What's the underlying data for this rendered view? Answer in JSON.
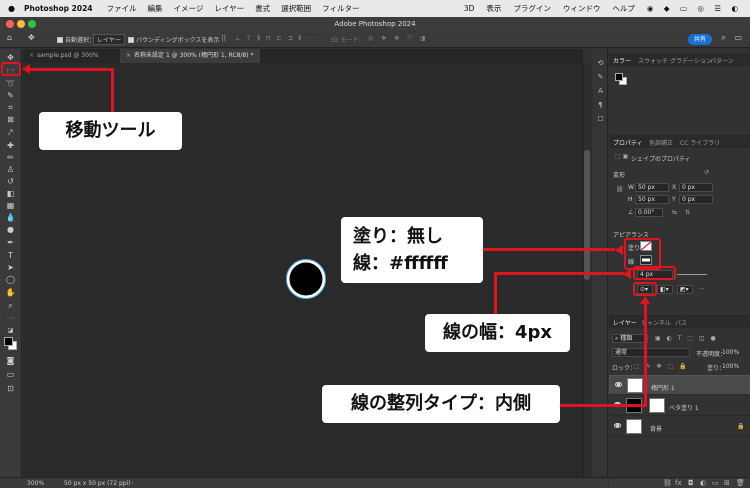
{
  "menubar": {
    "app": "Photoshop 2024",
    "items": [
      "ファイル",
      "編集",
      "イメージ",
      "レイヤー",
      "書式",
      "選択範囲",
      "フィルター",
      "3D",
      "表示",
      "プラグイン",
      "ウィンドウ",
      "ヘルプ"
    ]
  },
  "window_title": "Adobe Photoshop 2024",
  "options_bar": {
    "auto_select_label": "自動選択：",
    "auto_select_value": "レイヤー",
    "bounding_box_label": "バウンディングボックスを表示",
    "mode_3d": "3D モード：",
    "share_label": "共有"
  },
  "tabs": [
    {
      "label": "sample.psd @ 300% (RC8/8)"
    },
    {
      "label": "名称未設定 1 @ 300% (楕円形 1, RC8/8) *"
    }
  ],
  "panels": {
    "color_tabs": [
      "カラー",
      "スウォッチ",
      "グラデーション",
      "パターン"
    ],
    "prop_tabs": [
      "プロパティ",
      "色調補正",
      "CC ライブラリ"
    ],
    "shape_props": "シェイプのプロパティ",
    "transform_label": "変形",
    "w_label": "W",
    "w_value": "50 px",
    "h_label": "H",
    "h_value": "50 px",
    "x_label": "X",
    "x_value": "0 px",
    "y_label": "Y",
    "y_value": "0 px",
    "angle_value": "0.00°",
    "appearance_label": "アピアランス",
    "fill_label": "塗り",
    "stroke_label": "線",
    "stroke_width": "4 px",
    "layer_tabs": [
      "レイヤー",
      "チャンネル",
      "パス"
    ],
    "kind_label": "種類",
    "blend_mode": "通常",
    "opacity_label": "不透明度：",
    "opacity_value": "100%",
    "lock_label": "ロック：",
    "fill_pct_label": "塗り：",
    "fill_pct_value": "100%",
    "layers": [
      {
        "name": "楕円形 1"
      },
      {
        "name": "ベタ塗り 1"
      },
      {
        "name": "背景"
      }
    ]
  },
  "statusbar": {
    "zoom": "300%",
    "doc_info": "50 px x 50 px (72 ppi)"
  },
  "annotations": {
    "move_tool": "移動ツール",
    "fill_stroke_line1": "塗り：無し",
    "fill_stroke_line2": "線：#ffffff",
    "stroke_width": "線の幅：4px",
    "stroke_align": "線の整列タイプ：内側"
  },
  "colors": {
    "annotation_red": "#e0141e",
    "accent_blue": "#1a6fd1",
    "canvas_bg": "#2a2a2a"
  }
}
